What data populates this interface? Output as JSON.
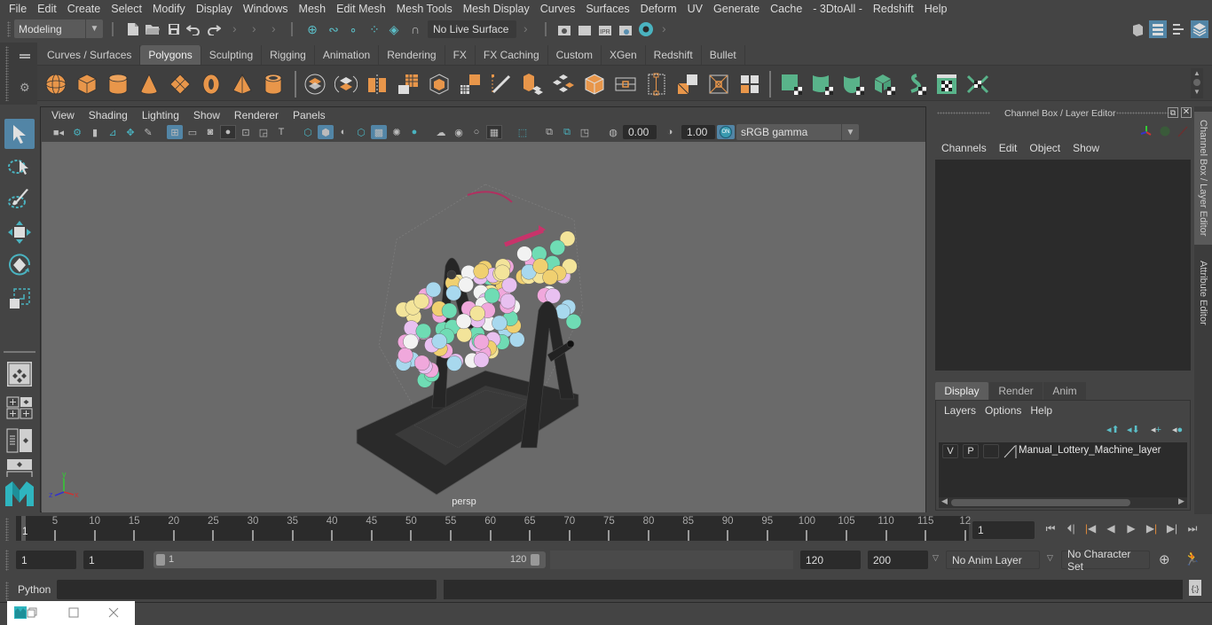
{
  "menubar": {
    "items": [
      "File",
      "Edit",
      "Create",
      "Select",
      "Modify",
      "Display",
      "Windows",
      "Mesh",
      "Edit Mesh",
      "Mesh Tools",
      "Mesh Display",
      "Curves",
      "Surfaces",
      "Deform",
      "UV",
      "Generate",
      "Cache",
      "- 3DtoAll -",
      "Redshift",
      "Help"
    ]
  },
  "statusline": {
    "workspace_menu": "Modeling",
    "live_surface": "No Live Surface"
  },
  "shelf": {
    "tabs": [
      "Curves / Surfaces",
      "Polygons",
      "Sculpting",
      "Rigging",
      "Animation",
      "Rendering",
      "FX",
      "FX Caching",
      "Custom",
      "XGen",
      "Redshift",
      "Bullet"
    ],
    "active_tab": "Polygons",
    "icons": [
      "poly-sphere",
      "poly-cube",
      "poly-cylinder",
      "poly-cone",
      "poly-plane",
      "poly-torus",
      "poly-pyramid",
      "poly-pipe",
      "combine",
      "separate",
      "mirror",
      "smooth",
      "boolean",
      "extract",
      "multi-cut",
      "bevel",
      "bridge",
      "extrude",
      "edge-loop",
      "insert-edge-loop",
      "offset-edge-loop",
      "bevel-edge",
      "target-weld",
      "merge",
      "planar-uv",
      "cylindrical-uv",
      "spherical-uv",
      "automatic-uv",
      "unfold-uv",
      "uv-editor",
      "layout-uv"
    ]
  },
  "viewport": {
    "menu": [
      "View",
      "Shading",
      "Lighting",
      "Show",
      "Renderer",
      "Panels"
    ],
    "exposure": "0.00",
    "gamma": "1.00",
    "color_mgmt_toggle": "ON",
    "color_space": "sRGB gamma",
    "camera_label": "persp",
    "axis_labels": {
      "x": "x",
      "y": "y",
      "z": "z"
    }
  },
  "channel_box": {
    "title": "Channel Box / Layer Editor",
    "menu": [
      "Channels",
      "Edit",
      "Object",
      "Show"
    ]
  },
  "layer_editor": {
    "tabs": [
      "Display",
      "Render",
      "Anim"
    ],
    "active_tab": "Display",
    "menu": [
      "Layers",
      "Options",
      "Help"
    ],
    "layers": [
      {
        "visible": "V",
        "playback": "P",
        "type": "",
        "name": "Manual_Lottery_Machine_layer"
      }
    ]
  },
  "side_tabs": [
    "Channel Box / Layer Editor",
    "Attribute Editor"
  ],
  "timeline": {
    "ticks": [
      5,
      10,
      15,
      20,
      25,
      30,
      35,
      40,
      45,
      50,
      55,
      60,
      65,
      70,
      75,
      80,
      85,
      90,
      95,
      100,
      105,
      110,
      115,
      12
    ],
    "current_frame_marker": "1",
    "current_frame": "1",
    "range_start": "1",
    "playback_start": "1",
    "slider_start": "1",
    "slider_end": "120",
    "playback_end": "120",
    "range_end": "200",
    "anim_layer": "No Anim Layer",
    "character_set": "No Character Set"
  },
  "command_line": {
    "language": "Python",
    "input": "",
    "output": ""
  },
  "taskbar_window": {
    "buttons": [
      "restore",
      "maximize",
      "close"
    ]
  }
}
